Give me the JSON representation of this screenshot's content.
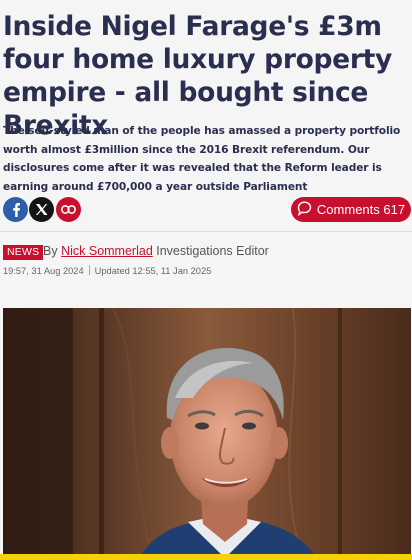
{
  "article": {
    "headline": "Inside Nigel Farage's £3m four home luxury property empire - all bought since Brexitx",
    "standfirst": "The self-styled man of the people has amassed a property portfolio worth almost £3million since the 2016 Brexit referendum. Our disclosures come after it was revealed that the Reform leader is earning around £700,000 a year outside Parliament"
  },
  "share": {
    "facebook_icon": "facebook-icon",
    "x_icon": "x-icon",
    "link_icon": "link-icon"
  },
  "comments": {
    "label": "Comments 617",
    "icon": "speech-bubble-icon"
  },
  "byline": {
    "section_badge": "NEWS",
    "by": "By",
    "author": "Nick Sommerlad",
    "role": "Investigations Editor",
    "published": "19:57, 31 Aug 2024",
    "updated": "Updated 12:55, 11 Jan 2025"
  },
  "colors": {
    "brand_red": "#c8102e",
    "headline": "#2b2f4f",
    "facebook": "#2d5fa8",
    "x": "#141414"
  }
}
